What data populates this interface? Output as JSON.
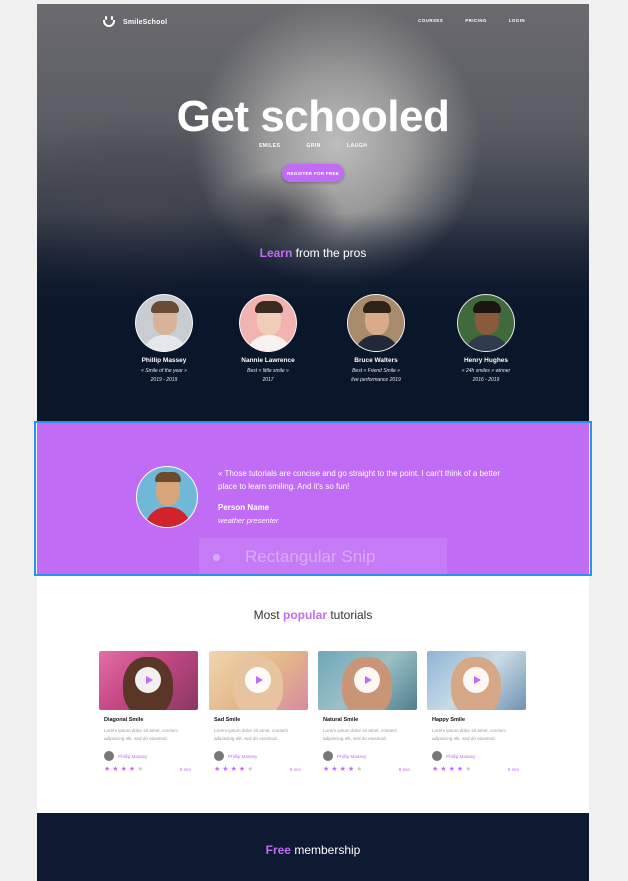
{
  "colors": {
    "accent": "#c06cf5",
    "dark_navy": "#0d1a32",
    "selection_border": "#2f8ff0"
  },
  "nav": {
    "logo_text": "SmileSchool",
    "links": [
      "COURSES",
      "PRICING",
      "LOGIN"
    ]
  },
  "hero": {
    "title": "Get schooled",
    "subtitles": [
      "SMILES",
      "GRIN",
      "LAUGH"
    ],
    "cta_label": "REGISTER FOR FREE",
    "learn_highlight": "Learn",
    "learn_rest": "from the pros"
  },
  "teachers": [
    {
      "name": "Phillip Massey",
      "desc1": "« Smile of the year »",
      "desc2": "2019 - 2019"
    },
    {
      "name": "Nannie Lawrence",
      "desc1": "Best « little smile »",
      "desc2": "2017"
    },
    {
      "name": "Bruce Walters",
      "desc1": "Best « Friend Smile »",
      "desc2": "live performance 2019"
    },
    {
      "name": "Henry Hughes",
      "desc1": "« 24h smiles » winner",
      "desc2": "2016 - 2019"
    }
  ],
  "testimonial": {
    "quote": "« Those tutorials are concise and go straight to the point. I can't think of a better place to learn smiling. And it's so fun!",
    "person_name": "Person Name",
    "person_role": "weather presenter",
    "snip_label": "Rectangular Snip"
  },
  "tutorials": {
    "title_pre": "Most",
    "title_highlight": "popular",
    "title_post": "tutorials",
    "cards": [
      {
        "title": "Diagonal Smile",
        "desc": "Lorem ipsum dolor sit amet, consect adipiscing elit, sed do eiusmod.",
        "author": "Phillip Massey",
        "rating": 4,
        "duration": "8 min"
      },
      {
        "title": "Sad Smile",
        "desc": "Lorem ipsum dolor sit amet, consect adipiscing elit, sed do eiusmod.",
        "author": "Phillip Massey",
        "rating": 4,
        "duration": "8 min"
      },
      {
        "title": "Natural Smile",
        "desc": "Lorem ipsum dolor sit amet, consect adipiscing elit, sed do eiusmod.",
        "author": "Phillip Massey",
        "rating": 4,
        "duration": "8 min"
      },
      {
        "title": "Happy Smile",
        "desc": "Lorem ipsum dolor sit amet, consect adipiscing elit, sed do eiusmod.",
        "author": "Phillip Massey",
        "rating": 4,
        "duration": "8 min"
      }
    ]
  },
  "membership": {
    "highlight": "Free",
    "rest": "membership"
  }
}
